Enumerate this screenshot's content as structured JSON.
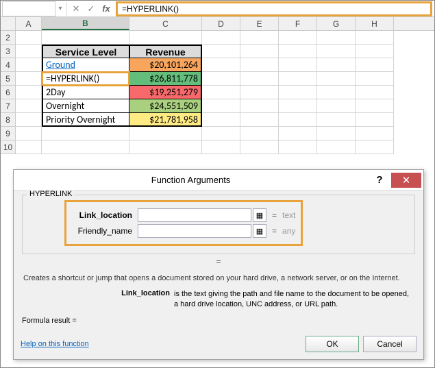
{
  "formula_bar": {
    "name_box": "",
    "cancel": "✕",
    "enter": "✓",
    "fx": "fx",
    "formula": "=HYPERLINK()"
  },
  "columns": [
    "A",
    "B",
    "C",
    "D",
    "E",
    "F",
    "G",
    "H"
  ],
  "rows": [
    "2",
    "3",
    "4",
    "5",
    "6",
    "7",
    "8",
    "9",
    "10"
  ],
  "active_col": "B",
  "table": {
    "headers": {
      "b": "Service Level",
      "c": "Revenue"
    },
    "rows": [
      {
        "b": "Ground",
        "c": "$20,101,264",
        "link": true,
        "fill": "bg-orange"
      },
      {
        "b": "=HYPERLINK()",
        "c": "$26,811,778",
        "highlight": true,
        "fill": "bg-green"
      },
      {
        "b": "2Day",
        "c": "$19,251,279",
        "fill": "bg-red"
      },
      {
        "b": "Overnight",
        "c": "$24,551,509",
        "fill": "bg-midgreen"
      },
      {
        "b": "Priority Overnight",
        "c": "$21,781,958",
        "fill": "bg-yellow"
      }
    ]
  },
  "dialog": {
    "title": "Function Arguments",
    "fn": "HYPERLINK",
    "args": [
      {
        "label": "Link_location",
        "bold": true,
        "value": "",
        "type": "text"
      },
      {
        "label": "Friendly_name",
        "bold": false,
        "value": "",
        "type": "any"
      }
    ],
    "eq": "=",
    "desc": "Creates a shortcut or jump that opens a document stored on your hard drive, a network server, or on the Internet.",
    "arg_desc_name": "Link_location",
    "arg_desc_text": "is the text giving the path and file name to the document to be opened, a hard drive location, UNC address, or URL path.",
    "result_label": "Formula result =",
    "result_value": "",
    "help": "Help on this function",
    "ok": "OK",
    "cancel": "Cancel"
  }
}
